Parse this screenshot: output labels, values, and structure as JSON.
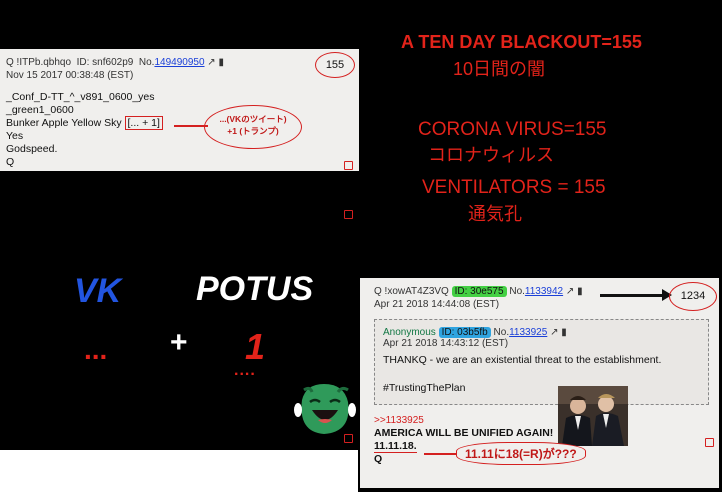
{
  "post1": {
    "name": "Q !ITPb.qbhqo",
    "id_label": "ID: snf602p9",
    "no_label": "No.",
    "post_number": "149490950",
    "date": "Nov 15 2017 00:38:48 (EST)",
    "body_lines": [
      "_Conf_D-TT_^_v891_0600_yes",
      "_green1_0600",
      "Bunker Apple Yellow Sky",
      "Yes",
      "Godspeed.",
      "Q"
    ],
    "boxed_text": "[... + 1]",
    "circled_number": "155",
    "annotation_line1": "...(VKのツイート)",
    "annotation_line2": "+1 (トランプ)"
  },
  "headlines": {
    "blackout": "A TEN DAY BLACKOUT=155",
    "blackout_jp": "10日間の闇",
    "corona": "CORONA VIRUS=155",
    "corona_jp": "コロナウィルス",
    "ventilators": "VENTILATORS = 155",
    "ventilators_jp": "通気孔"
  },
  "graphic": {
    "vk": "VK",
    "potus": "POTUS",
    "dots": "...",
    "plus": "+",
    "one": "1",
    "one_dots": "...."
  },
  "post2": {
    "name": "Q !xowAT4Z3VQ",
    "id_label": "ID: 30e575",
    "no_label": "No.",
    "post_number": "1133942",
    "date": "Apr 21 2018 14:44:08 (EST)",
    "circled_number": "1234",
    "quote": {
      "name": "Anonymous",
      "id_label": "ID: 03b5fb",
      "no_label": "No.",
      "post_number": "1133925",
      "date": "Apr 21 2018 14:43:12 (EST)",
      "text1": "THANKQ - we are an existential threat to the establishment.",
      "text2": "#TrustingThePlan"
    },
    "reply_link": ">>1133925",
    "body1": "AMERICA WILL BE UNIFIED AGAIN!",
    "body2": "11.11.18.",
    "body3": "Q",
    "annotation": "11.11に18(=R)が???"
  },
  "colors": {
    "accent_red": "#e2231a",
    "vk_blue": "#2255e0",
    "id_green": "#44d044",
    "id_blue": "#2fa4e0"
  }
}
